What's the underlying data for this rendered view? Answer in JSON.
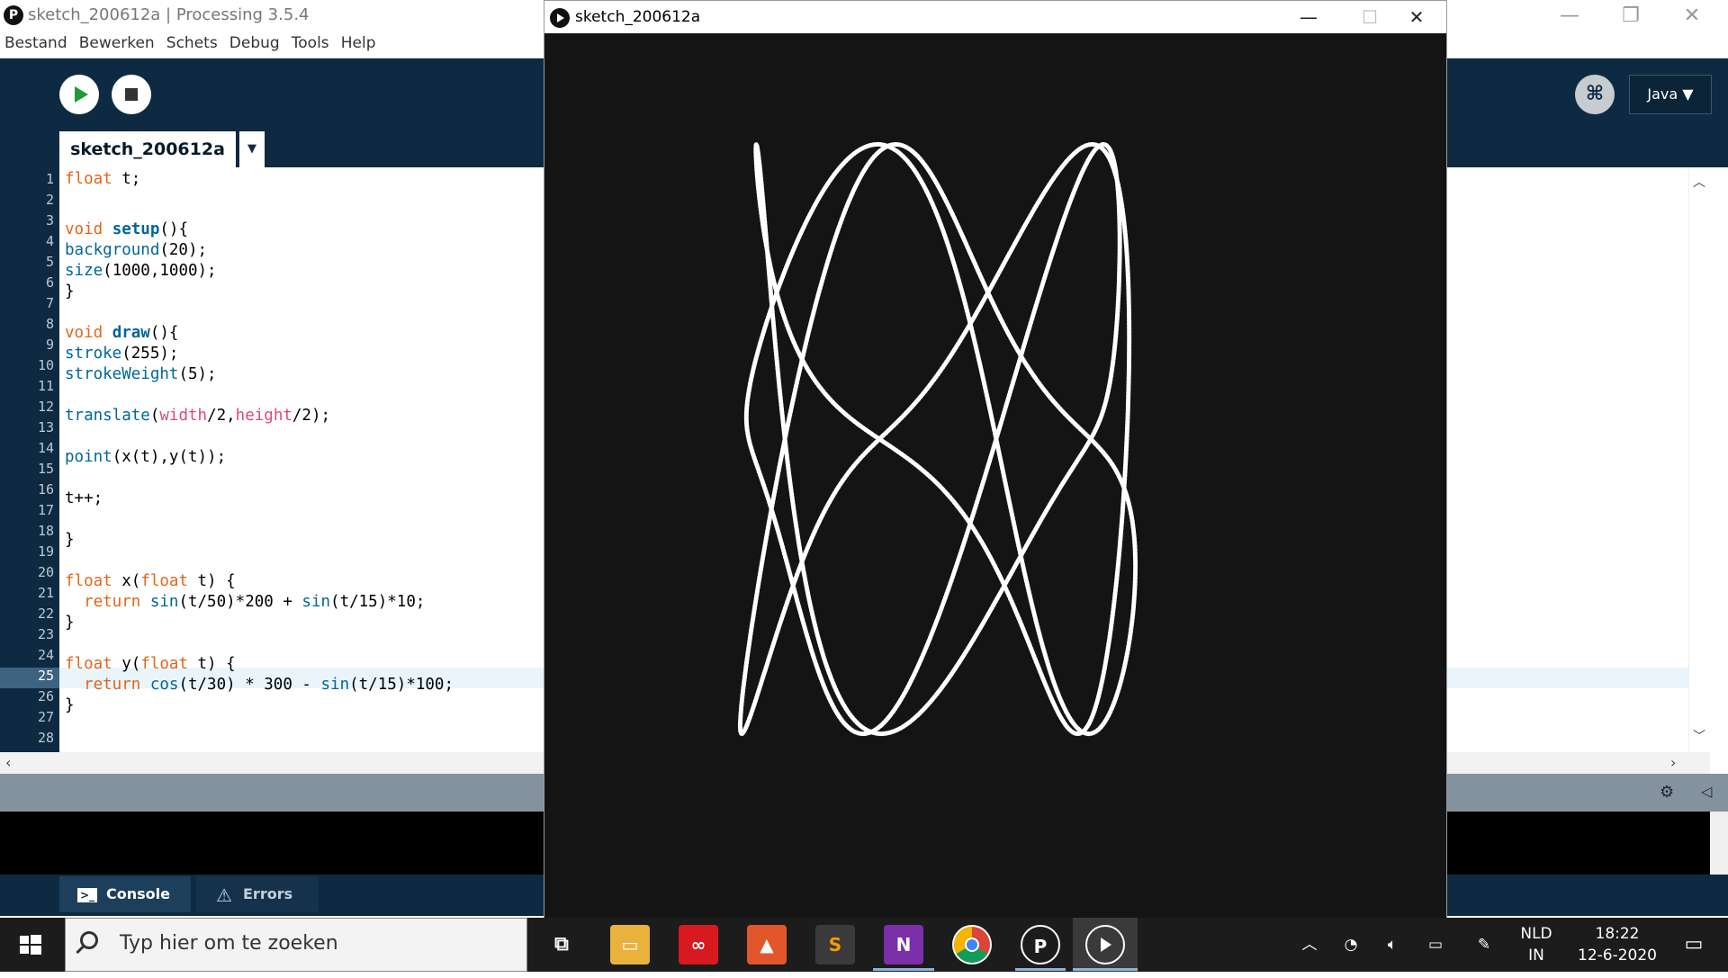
{
  "window": {
    "title": "sketch_200612a | Processing 3.5.4",
    "logo_glyph": "P"
  },
  "menu": [
    "Bestand",
    "Bewerken",
    "Schets",
    "Debug",
    "Tools",
    "Help"
  ],
  "toolbar": {
    "mode_label": "Java ▼",
    "debug_glyph": "⌘"
  },
  "tab": {
    "label": "sketch_200612a",
    "arrow": "▼"
  },
  "code": {
    "active_line": 25,
    "line_numbers": [
      "1",
      "2",
      "3",
      "4",
      "5",
      "6",
      "7",
      "8",
      "9",
      "10",
      "11",
      "12",
      "13",
      "14",
      "15",
      "16",
      "17",
      "18",
      "19",
      "20",
      "21",
      "22",
      "23",
      "24",
      "25",
      "26",
      "27",
      "28"
    ]
  },
  "console_tabs": {
    "console": "Console",
    "errors": "Errors",
    "console_glyph": ">_",
    "errors_glyph": "⚠"
  },
  "sketch_window": {
    "title": "sketch_200612a",
    "background": "#141414",
    "stroke": "#ffffff"
  },
  "taskbar": {
    "search_placeholder": "Typ hier om te zoeken",
    "lang_top": "NLD",
    "lang_bottom": "IN",
    "time": "18:22",
    "date": "12-6-2020"
  },
  "colors": {
    "ide_dark": "#0d2a42",
    "keyword": "#e2661a",
    "function": "#006699",
    "variable": "#d94a7a"
  }
}
